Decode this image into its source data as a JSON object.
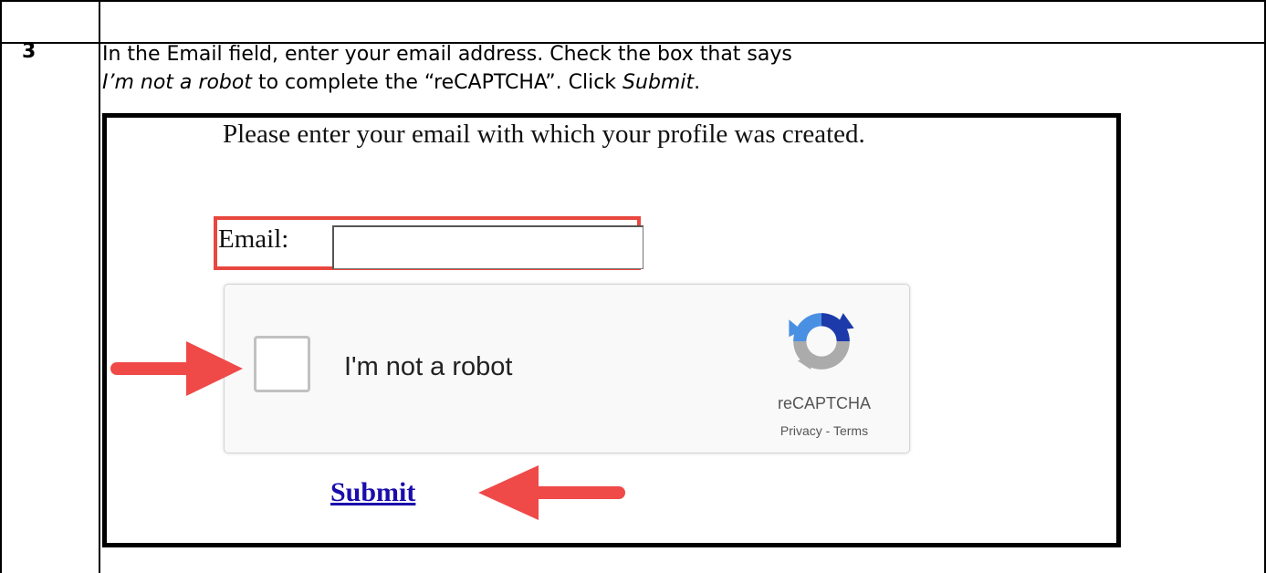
{
  "step": {
    "number": "3",
    "line1": "In the Email field, enter your email address. Check the box that says",
    "line2_italic_a": "I’m not a robot",
    "line2_middle": " to complete the “reCAPTCHA”. Click ",
    "line2_italic_b": "Submit",
    "line2_end": "."
  },
  "form": {
    "prompt": "Please enter your email with which your profile was created.",
    "email_label": "Email:",
    "email_value": "",
    "submit_label": "Submit"
  },
  "captcha": {
    "label": "I'm not a robot",
    "brand": "reCAPTCHA",
    "privacy": "Privacy",
    "separator": " - ",
    "terms": "Terms"
  },
  "colors": {
    "highlight": "#e8473f",
    "arrow": "#ef4a48",
    "link": "#1a0dab"
  }
}
